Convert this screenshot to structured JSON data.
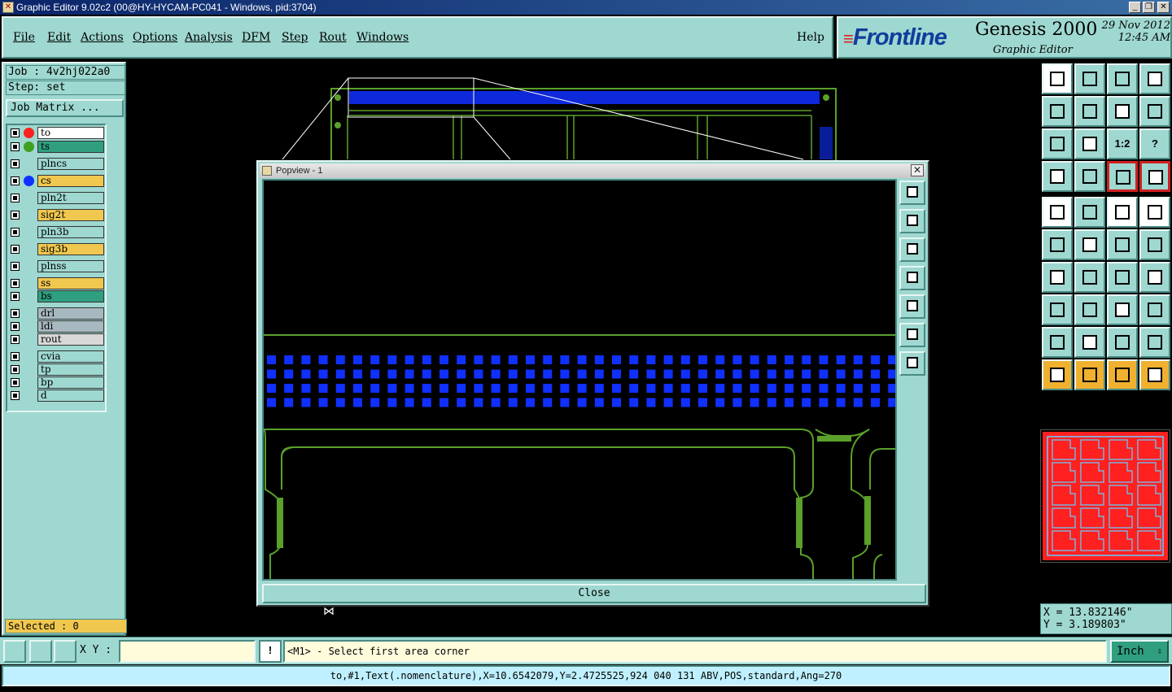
{
  "window": {
    "title": "Graphic Editor 9.02c2 (00@HY-HYCAM-PC041 - Windows, pid:3704)",
    "minimize": "_",
    "restore": "❐",
    "close": "✕"
  },
  "menu": {
    "items": [
      "File",
      "Edit",
      "Actions",
      "Options",
      "Analysis",
      "DFM",
      "Step",
      "Rout",
      "Windows"
    ],
    "help": "Help"
  },
  "brand": {
    "logo": "Frontline",
    "product": "Genesis 2000",
    "subtitle": "Graphic Editor",
    "date": "29 Nov 2012",
    "time": "12:45 AM"
  },
  "job": {
    "job_text": "Job : 4v2hj022a0",
    "step_text": "Step: set",
    "matrix_button": "Job Matrix ..."
  },
  "layers": [
    {
      "name": "to",
      "color": "#ffffff",
      "dot": "#ff2020"
    },
    {
      "name": "ts",
      "color": "#2f9f7f",
      "dot": "#40a020"
    },
    {
      "name": "plncs",
      "color": "#9ed8d0",
      "dot": ""
    },
    {
      "name": "cs",
      "color": "#f0c850",
      "dot": "#1030ff"
    },
    {
      "name": "pln2t",
      "color": "#9ed8d0",
      "dot": ""
    },
    {
      "name": "sig2t",
      "color": "#f0c850",
      "dot": ""
    },
    {
      "name": "pln3b",
      "color": "#9ed8d0",
      "dot": ""
    },
    {
      "name": "sig3b",
      "color": "#f0c850",
      "dot": ""
    },
    {
      "name": "plnss",
      "color": "#9ed8d0",
      "dot": ""
    },
    {
      "name": "ss",
      "color": "#f0c850",
      "dot": ""
    },
    {
      "name": "bs",
      "color": "#2f9f7f",
      "dot": ""
    },
    {
      "name": "drl",
      "color": "#a8b8c0",
      "dot": ""
    },
    {
      "name": "ldi",
      "color": "#a8b8c0",
      "dot": ""
    },
    {
      "name": "rout",
      "color": "#d8d8d8",
      "dot": ""
    },
    {
      "name": "cvia",
      "color": "#9ed8d0",
      "dot": ""
    },
    {
      "name": "tp",
      "color": "#9ed8d0",
      "dot": ""
    },
    {
      "name": "bp",
      "color": "#9ed8d0",
      "dot": ""
    },
    {
      "name": "d",
      "color": "#9ed8d0",
      "dot": ""
    }
  ],
  "selected": "Selected : 0",
  "popview": {
    "title": "Popview - 1",
    "close_x": "✕",
    "close_button": "Close"
  },
  "toolbox": {
    "ratio_label": "1:2",
    "help_label": "?"
  },
  "coords": {
    "x": "X = 13.832146\"",
    "y": "Y = 3.189803\""
  },
  "bottom": {
    "xy_label": "X Y :",
    "xy_value": "",
    "warn_label": "!",
    "prompt": "<M1> - Select first area corner",
    "unit": "Inch",
    "unit_chevron": "⇩"
  },
  "status": "to,#1,Text(.nomenclature),X=10.6542079,Y=2.4725525,924 040 131 ABV,POS,standard,Ang=270",
  "colors": {
    "panel": "#9ed8d0",
    "pad_blue": "#1030ff",
    "trace_green": "#5aa02a"
  }
}
